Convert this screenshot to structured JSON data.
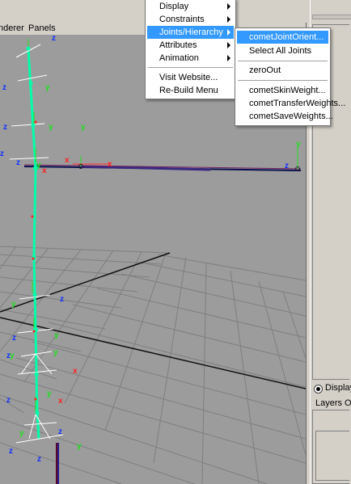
{
  "panel_menubar": {
    "renderer": "nderer",
    "panels": "Panels"
  },
  "menu_main": {
    "items": [
      "Display",
      "Constraints",
      "Joints/Hierarchy",
      "Attributes",
      "Animation",
      "Visit Website...",
      "Re-Build Menu"
    ]
  },
  "menu_sub": {
    "items": [
      "cometJointOrient...",
      "Select All Joints",
      "zeroOut",
      "cometSkinWeight...",
      "cometTransferWeights...",
      "cometSaveWeights..."
    ]
  },
  "right_panel": {
    "display_label": "Display",
    "layers_label": "Layers",
    "o_label": "O"
  },
  "viewport": {
    "axis_labels": {
      "x": "x",
      "y": "y",
      "z": "z"
    }
  },
  "colors": {
    "joint": "#00ffaa",
    "x_axis": "#ff2020",
    "y_axis": "#22dd22",
    "z_axis": "#1030ff",
    "highlight": "#3399ff"
  }
}
